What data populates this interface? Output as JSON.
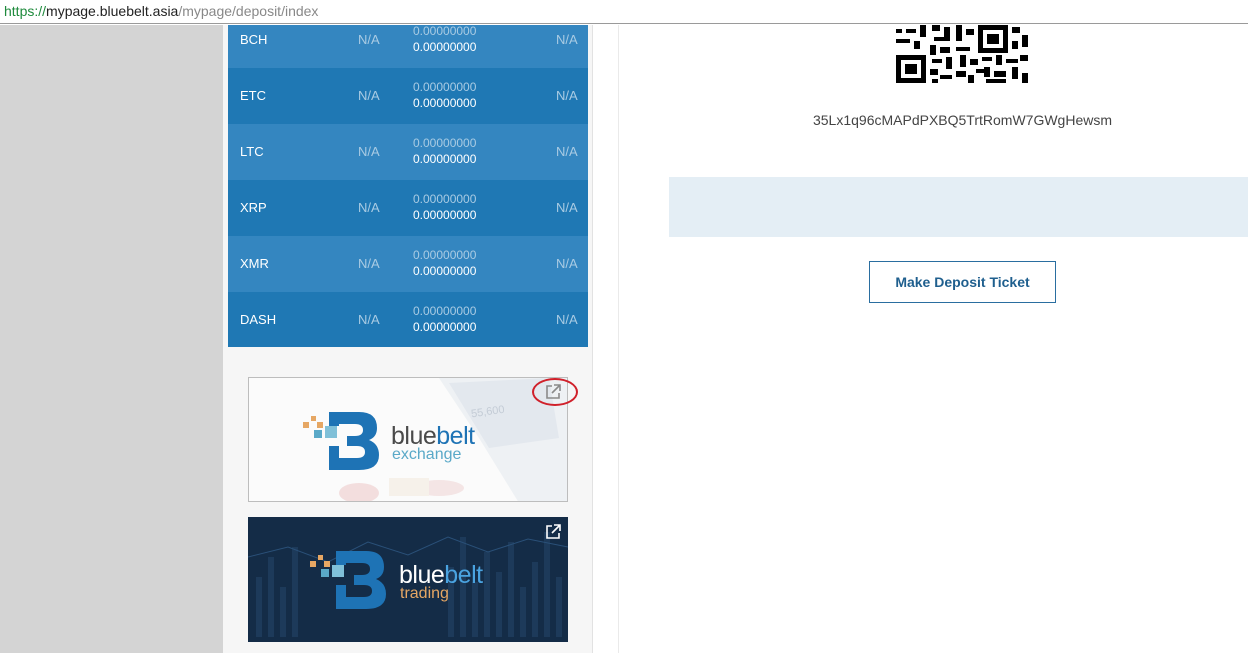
{
  "browser": {
    "url_scheme": "https://",
    "url_host": "mypage.bluebelt.asia",
    "url_path": "/mypage/deposit/index"
  },
  "currencies": [
    {
      "symbol": "BCH",
      "col1": "N/A",
      "amount_top": "0.00000000",
      "amount_bottom": "0.00000000",
      "col2": "N/A"
    },
    {
      "symbol": "ETC",
      "col1": "N/A",
      "amount_top": "0.00000000",
      "amount_bottom": "0.00000000",
      "col2": "N/A"
    },
    {
      "symbol": "LTC",
      "col1": "N/A",
      "amount_top": "0.00000000",
      "amount_bottom": "0.00000000",
      "col2": "N/A"
    },
    {
      "symbol": "XRP",
      "col1": "N/A",
      "amount_top": "0.00000000",
      "amount_bottom": "0.00000000",
      "col2": "N/A"
    },
    {
      "symbol": "XMR",
      "col1": "N/A",
      "amount_top": "0.00000000",
      "amount_bottom": "0.00000000",
      "col2": "N/A"
    },
    {
      "symbol": "DASH",
      "col1": "N/A",
      "amount_top": "0.00000000",
      "amount_bottom": "0.00000000",
      "col2": "N/A"
    }
  ],
  "banners": {
    "exchange": {
      "word1": "blue",
      "word2": "belt",
      "sub": "exchange",
      "bg_number": "55,600"
    },
    "trading": {
      "word1": "blue",
      "word2": "belt",
      "sub": "trading"
    }
  },
  "deposit": {
    "wallet_address": "35Lx1q96cMAPdPXBQ5TrtRomW7GWgHewsm",
    "button_label": "Make Deposit Ticket"
  },
  "colors": {
    "row_alt": "#3486c0",
    "row_base": "#1f78b4",
    "brand_blue": "#1e73b5",
    "trading_sub": "#e6a764",
    "button_text": "#1f5f8e"
  },
  "icons": {
    "external_link": "external-link-icon",
    "qr": "qr-code-icon"
  }
}
